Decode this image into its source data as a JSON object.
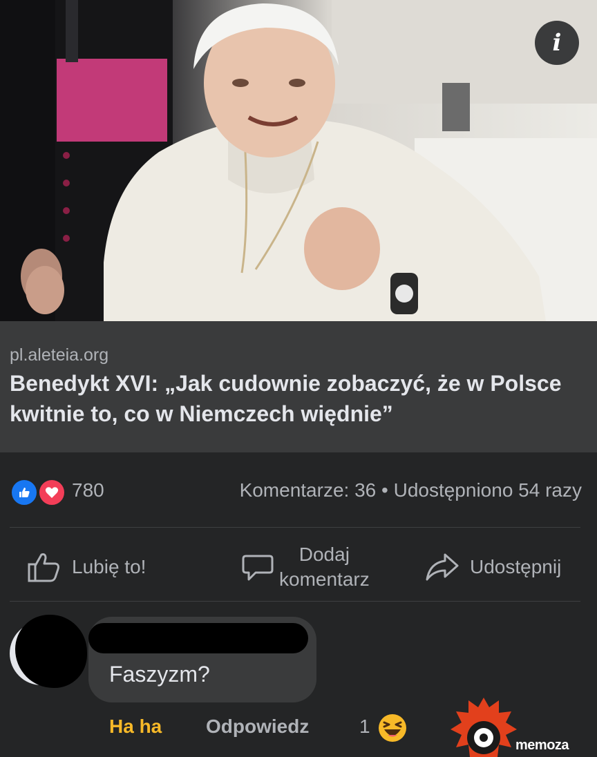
{
  "post": {
    "link": {
      "domain": "pl.aleteia.org",
      "headline": "Benedykt XVI: „Jak cudownie zobaczyć, że w Polsce kwitnie to, co w Niemczech więdnie”"
    },
    "reactions": {
      "icons": [
        "like-icon",
        "love-icon"
      ],
      "count": "780"
    },
    "stats": "Komentarze: 36 • Udostępniono 54 razy",
    "actions": {
      "like": "Lubię to!",
      "comment_line1": "Dodaj",
      "comment_line2": "komentarz",
      "share": "Udostępnij"
    }
  },
  "comment": {
    "text": "Faszyzm?",
    "haha": "Ha ha",
    "reply": "Odpowiedz",
    "reaction_count": "1",
    "reaction_icon": "haha-emoji-icon"
  },
  "watermark": "memoza",
  "colors": {
    "background": "#242526",
    "card": "#3a3b3c",
    "secondary_text": "#b0b3b8",
    "like_blue": "#1877f2",
    "love_red": "#f33e58",
    "haha_yellow": "#f7b928"
  }
}
